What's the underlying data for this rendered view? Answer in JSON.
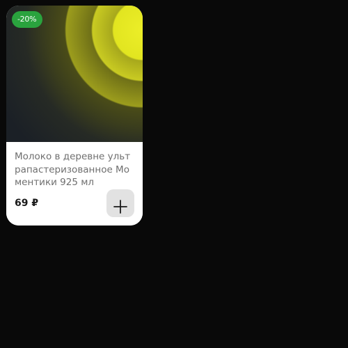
{
  "product_card": {
    "discount_badge": "-20%",
    "name": "Молоко в деревне ультрапастеризованное Моментики 925 мл",
    "price": "69 ₽",
    "add_icon": "plus-icon",
    "colors": {
      "badge": "#2aa33e",
      "image_glow": "#ecee28",
      "card_bg": "#ffffff",
      "page_bg": "#090909"
    }
  }
}
